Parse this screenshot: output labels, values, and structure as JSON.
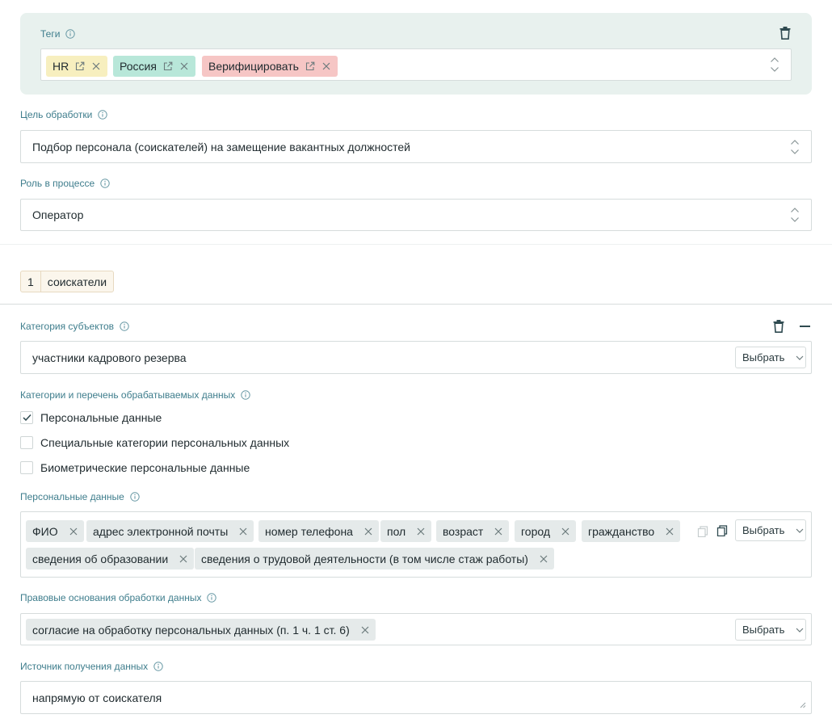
{
  "tags_section": {
    "label": "Теги",
    "tags": [
      {
        "text": "HR",
        "color": "#f7efbf"
      },
      {
        "text": "Россия",
        "color": "#b8e7d9"
      },
      {
        "text": "Верифицировать",
        "color": "#f6c6c5"
      }
    ]
  },
  "purpose": {
    "label": "Цель обработки",
    "value": "Подбор персонала (соискателей) на замещение вакантных должностей"
  },
  "role": {
    "label": "Роль в процессе",
    "value": "Оператор"
  },
  "subject_counter": {
    "number": "1",
    "name": "соискатели"
  },
  "subject_category": {
    "label": "Категория субъектов",
    "value": "участники кадрового резерва",
    "button": "Выбрать"
  },
  "data_categories": {
    "label": "Категории и перечень обрабатываемых данных",
    "items": [
      {
        "label": "Персональные данные",
        "checked": true
      },
      {
        "label": "Специальные категории персональных данных",
        "checked": false
      },
      {
        "label": "Биометрические персональные данные",
        "checked": false
      }
    ]
  },
  "personal_data": {
    "label": "Персональные данные",
    "chips": [
      "ФИО",
      "адрес электронной почты",
      "номер телефона",
      "пол",
      "возраст",
      "город",
      "гражданство",
      "сведения об образовании",
      "сведения о трудовой деятельности (в том числе стаж работы)"
    ],
    "button": "Выбрать"
  },
  "legal_basis": {
    "label": "Правовые основания обработки данных",
    "chips": [
      "согласие на обработку персональных данных (п. 1 ч. 1 ст. 6)"
    ],
    "button": "Выбрать"
  },
  "data_source": {
    "label": "Источник получения данных",
    "value": "напрямую от соискателя"
  }
}
